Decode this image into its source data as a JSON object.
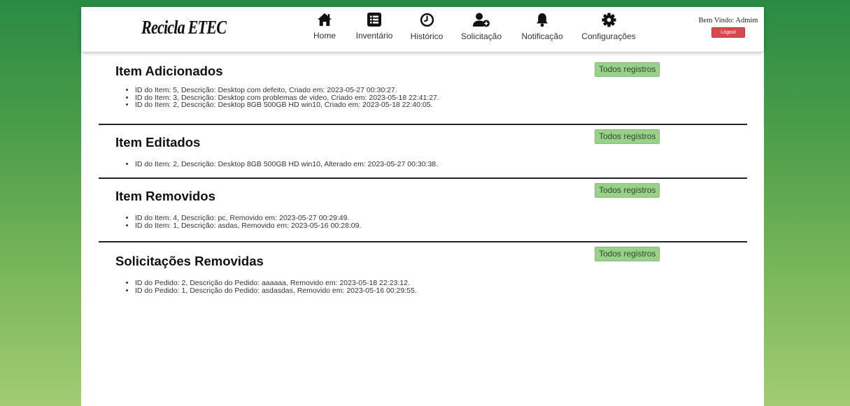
{
  "app": {
    "logo": "Recicla ETEC",
    "user_greeting": "Bem Vindo: Admim",
    "logout_label": "Logout"
  },
  "nav": {
    "home": {
      "label": "Home",
      "icon": "home-icon"
    },
    "inventario": {
      "label": "Inventário",
      "icon": "list-icon"
    },
    "historico": {
      "label": "Histórico",
      "icon": "clock-icon"
    },
    "solicitacao": {
      "label": "Solicitação",
      "icon": "user-add-icon"
    },
    "notificacao": {
      "label": "Notificação",
      "icon": "bell-icon"
    },
    "configuracoes": {
      "label": "Configurações",
      "icon": "gear-icon"
    }
  },
  "button_all": "Todos registros",
  "sections": [
    {
      "title": "Item Adicionados",
      "items": [
        "ID do Item: 5, Descrição: Desktop com defeito, Criado em: 2023-05-27 00:30:27.",
        "ID do Item: 3, Descrição: Desktop com problemas de video, Criado em: 2023-05-18 22:41:27.",
        "ID do Item: 2, Descrição: Desktop 8GB 500GB HD win10, Criado em: 2023-05-18 22:40:05."
      ]
    },
    {
      "title": "Item Editados",
      "items": [
        "ID do Item: 2, Descrição: Desktop 8GB 500GB HD win10, Alterado em: 2023-05-27 00:30:38."
      ]
    },
    {
      "title": "Item Removidos",
      "items": [
        "ID do Item: 4, Descrição: pc, Removido em: 2023-05-27 00:29:49.",
        "ID do Item: 1, Descrição: asdas, Removido em: 2023-05-16 00:28:09."
      ]
    },
    {
      "title": "Solicitações Removidas",
      "items": [
        "ID do Pedido: 2, Descrição do Pedido: aaaaaa, Removido em: 2023-05-18 22:23:12.",
        "ID do Pedido: 1, Descrição do Pedido: asdasdas, Removido em: 2023-05-16 00:29:55."
      ]
    }
  ],
  "colors": {
    "button_green": "#99d08a",
    "logout_red": "#d64a4f",
    "background_green": "#2a8a43"
  }
}
